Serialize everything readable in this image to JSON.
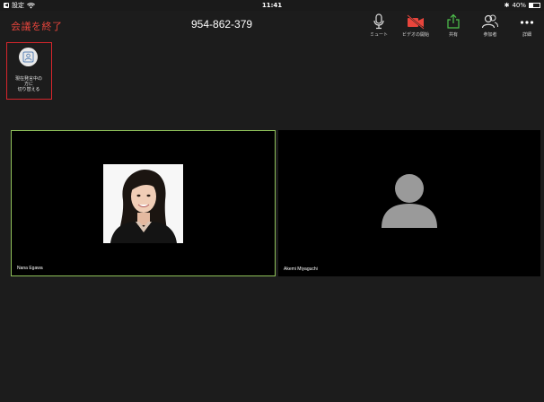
{
  "statusbar": {
    "back_app": "設定",
    "time": "11:41",
    "battery_percent": "40%",
    "battery_level": 0.4
  },
  "toolbar": {
    "end_meeting": "会議を終了",
    "meeting_id": "954-862-379",
    "buttons": [
      {
        "label": "ミュート",
        "icon": "microphone-icon"
      },
      {
        "label": "ビデオの開始",
        "icon": "video-off-icon",
        "color": "#e8453c"
      },
      {
        "label": "共有",
        "icon": "share-icon",
        "color": "#4fc44d"
      },
      {
        "label": "参加者",
        "icon": "participants-icon"
      },
      {
        "label": "詳細",
        "icon": "more-icon"
      }
    ]
  },
  "switch_view": {
    "label_line1": "現在発言中の",
    "label_line2": "方に",
    "label_line3": "切り替える",
    "icon": "active-speaker-icon"
  },
  "participants": [
    {
      "name": "Nana Egawa",
      "active": true,
      "has_video": true
    },
    {
      "name": "Akemi Miyaguchi",
      "active": false,
      "has_video": false
    }
  ],
  "colors": {
    "end_meeting": "#e8453c",
    "active_border": "#8fc15a",
    "switch_highlight": "#d6262c"
  }
}
